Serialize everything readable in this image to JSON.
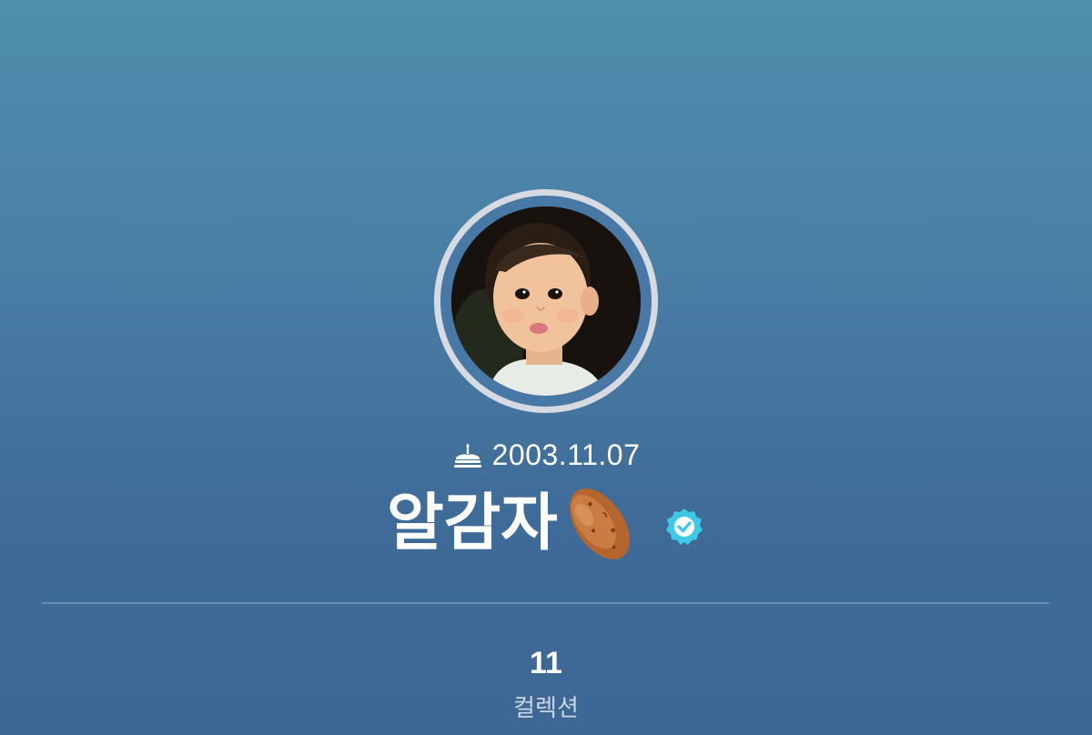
{
  "profile": {
    "birthday": "2003.11.07",
    "display_name": "알감자",
    "name_emoji": "potato-icon",
    "verified": true,
    "avatar": "avatar-photo-toddler"
  },
  "stats": {
    "collection_count": "11",
    "collection_label": "컬렉션"
  },
  "colors": {
    "background_top": "#4f8fad",
    "background_bottom": "#3d6896",
    "avatar_ring": "#d7dbe1",
    "verified_badge": "#3ec9e6"
  }
}
